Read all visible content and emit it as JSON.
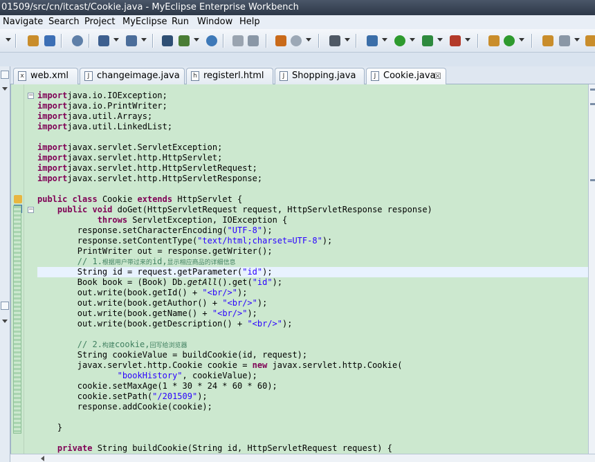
{
  "window": {
    "title": "01509/src/cn/itcast/Cookie.java - MyEclipse Enterprise Workbench"
  },
  "menubar": {
    "items": [
      "Navigate",
      "Search",
      "Project",
      "MyEclipse",
      "Run",
      "Window",
      "Help"
    ]
  },
  "toolbar": {
    "icons": [
      "new-wizard-icon",
      "open-type-icon",
      "save-icon",
      "build-icon",
      "search-icon",
      "open-element-icon",
      "web-browser-icon",
      "deploy-icon",
      "server-icon",
      "run-config-icon",
      "debug-icon",
      "run-icon",
      "external-tools-icon",
      "coverage-icon",
      "open-perspective-icon",
      "refresh-icon",
      "task-icon",
      "pin-icon",
      "nav-icon"
    ],
    "colors": {
      "run": "#2e9a2e",
      "debug": "#3b6ea8",
      "deploy": "#c96a1a"
    }
  },
  "tabs": [
    {
      "label": "web.xml",
      "icon": "xml-file-icon",
      "active": false
    },
    {
      "label": "changeimage.java",
      "icon": "java-file-icon",
      "active": false
    },
    {
      "label": "registerl.html",
      "icon": "html-file-icon",
      "active": false
    },
    {
      "label": "Shopping.java",
      "icon": "java-file-icon",
      "active": false
    },
    {
      "label": "Cookie.java",
      "icon": "java-file-icon",
      "active": true,
      "close": "☒"
    }
  ],
  "editor": {
    "background": "#cce8cf",
    "current_line": 17,
    "lines": [
      [
        [
          "kw",
          "import"
        ],
        [
          "",
          "java.io.IOException;"
        ]
      ],
      [
        [
          "kw",
          "import"
        ],
        [
          "",
          "java.io.PrintWriter;"
        ]
      ],
      [
        [
          "kw",
          "import"
        ],
        [
          "",
          "java.util.Arrays;"
        ]
      ],
      [
        [
          "kw",
          "import"
        ],
        [
          "",
          "java.util.LinkedList;"
        ]
      ],
      [],
      [
        [
          "kw",
          "import"
        ],
        [
          "",
          "javax.servlet.ServletException;"
        ]
      ],
      [
        [
          "kw",
          "import"
        ],
        [
          "",
          "javax.servlet.http.HttpServlet;"
        ]
      ],
      [
        [
          "kw",
          "import"
        ],
        [
          "",
          "javax.servlet.http.HttpServletRequest;"
        ]
      ],
      [
        [
          "kw",
          "import"
        ],
        [
          "",
          "javax.servlet.http.HttpServletResponse;"
        ]
      ],
      [],
      [
        [
          "kw",
          "public"
        ],
        [
          "",
          " "
        ],
        [
          "kw",
          "class"
        ],
        [
          "",
          " Cookie "
        ],
        [
          "kw",
          "extends"
        ],
        [
          "",
          " HttpServlet {"
        ]
      ],
      [
        [
          "",
          "    "
        ],
        [
          "kw",
          "public"
        ],
        [
          "",
          " "
        ],
        [
          "kw",
          "void"
        ],
        [
          "",
          " doGet(HttpServletRequest request, HttpServletResponse response)"
        ]
      ],
      [
        [
          "",
          "            "
        ],
        [
          "kw",
          "throws"
        ],
        [
          "",
          " ServletException, IOException {"
        ]
      ],
      [
        [
          "",
          "        response.setCharacterEncoding("
        ],
        [
          "str",
          "\"UTF-8\""
        ],
        [
          "",
          ");"
        ]
      ],
      [
        [
          "",
          "        response.setContentType("
        ],
        [
          "str",
          "\"text/html;charset=UTF-8\""
        ],
        [
          "",
          ");"
        ]
      ],
      [
        [
          "",
          "        PrintWriter out = response.getWriter();"
        ]
      ],
      [
        [
          "",
          "        "
        ],
        [
          "cmt",
          "// 1."
        ],
        [
          "cmt-cn",
          "根据用户带过来的"
        ],
        [
          "cmt",
          "id,"
        ],
        [
          "cmt-cn",
          "显示相应商品的详细信息"
        ]
      ],
      [
        [
          "",
          "        String id = request.getParameter("
        ],
        [
          "str",
          "\"id\""
        ],
        [
          "",
          ");"
        ]
      ],
      [
        [
          "",
          "        Book book = (Book) Db."
        ],
        [
          "it",
          "getAll"
        ],
        [
          "",
          "().get("
        ],
        [
          "str",
          "\"id\""
        ],
        [
          "",
          ");"
        ]
      ],
      [
        [
          "",
          "        out.write(book.getId() + "
        ],
        [
          "str",
          "\"<br/>\""
        ],
        [
          "",
          ");"
        ]
      ],
      [
        [
          "",
          "        out.write(book.getAuthor() + "
        ],
        [
          "str",
          "\"<br/>\""
        ],
        [
          "",
          ");"
        ]
      ],
      [
        [
          "",
          "        out.write(book.getName() + "
        ],
        [
          "str",
          "\"<br/>\""
        ],
        [
          "",
          ");"
        ]
      ],
      [
        [
          "",
          "        out.write(book.getDescription() + "
        ],
        [
          "str",
          "\"<br/>\""
        ],
        [
          "",
          ");"
        ]
      ],
      [],
      [
        [
          "",
          "        "
        ],
        [
          "cmt",
          "// 2."
        ],
        [
          "cmt-cn",
          "构建"
        ],
        [
          "cmt",
          "cookie,"
        ],
        [
          "cmt-cn",
          "回写给浏览器"
        ]
      ],
      [
        [
          "",
          "        String cookieValue = buildCookie(id, request);"
        ]
      ],
      [
        [
          "",
          "        javax.servlet.http.Cookie cookie = "
        ],
        [
          "kw",
          "new"
        ],
        [
          "",
          " javax.servlet.http.Cookie("
        ]
      ],
      [
        [
          "",
          "                "
        ],
        [
          "str",
          "\"bookHistory\""
        ],
        [
          "",
          ", cookieValue);"
        ]
      ],
      [
        [
          "",
          "        cookie.setMaxAge(1 * 30 * 24 * 60 * 60);"
        ]
      ],
      [
        [
          "",
          "        cookie.setPath("
        ],
        [
          "str",
          "\"/201509\""
        ],
        [
          "",
          ");"
        ]
      ],
      [
        [
          "",
          "        response.addCookie(cookie);"
        ]
      ],
      [],
      [
        [
          "",
          "    }"
        ]
      ],
      [],
      [
        [
          "",
          "    "
        ],
        [
          "kw",
          "private"
        ],
        [
          "",
          " String buildCookie(String id, HttpServletRequest request) {"
        ]
      ]
    ]
  }
}
